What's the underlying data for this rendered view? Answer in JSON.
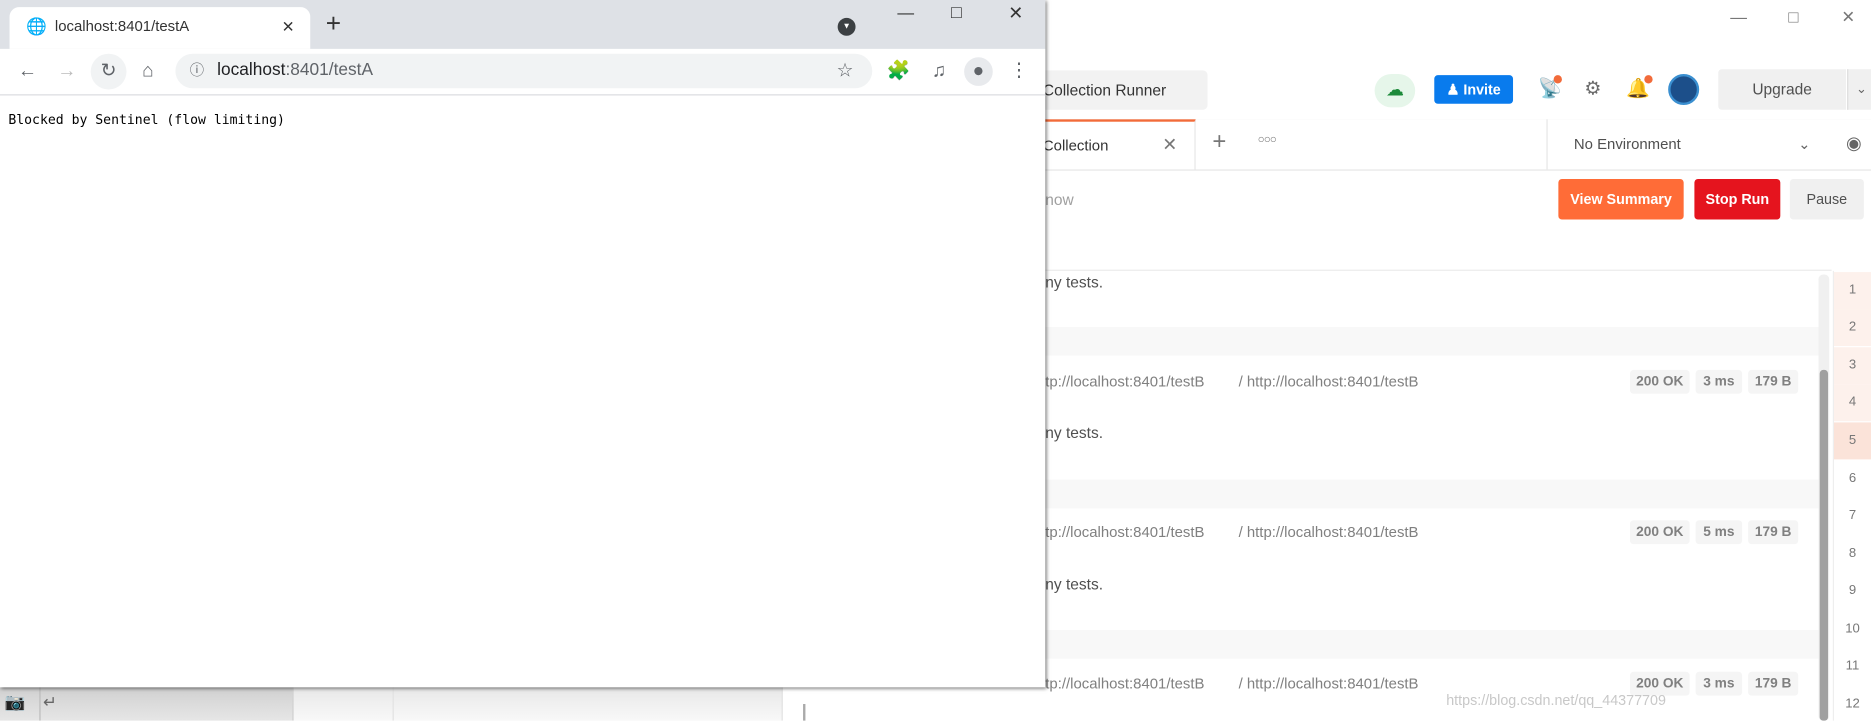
{
  "postman": {
    "header": {
      "runner_tab": "Collection Runner",
      "invite_label": "Invite",
      "upgrade_label": "Upgrade"
    },
    "tabs": {
      "active_tab": "Collection",
      "environment": "No Environment"
    },
    "run_bar": {
      "status_fragment": "now",
      "view_summary": "View Summary",
      "stop_run": "Stop Run",
      "pause": "Pause"
    },
    "results": [
      {
        "tests_text": "ny tests.",
        "url_fragment": "tp://localhost:8401/testB",
        "full_url": "/ http://localhost:8401/testB",
        "status": "200 OK",
        "time": "3 ms",
        "size": "179 B"
      },
      {
        "tests_text": "ny tests.",
        "url_fragment": "tp://localhost:8401/testB",
        "full_url": "/ http://localhost:8401/testB",
        "status": "200 OK",
        "time": "5 ms",
        "size": "179 B"
      },
      {
        "tests_text": "ny tests.",
        "url_fragment": "tp://localhost:8401/testB",
        "full_url": "/ http://localhost:8401/testB",
        "status": "200 OK",
        "time": "3 ms",
        "size": "179 B"
      }
    ],
    "line_numbers": [
      "1",
      "2",
      "3",
      "4",
      "5",
      "6",
      "7",
      "8",
      "9",
      "10",
      "11",
      "12"
    ],
    "watermark": "https://blog.csdn.net/qq_44377709",
    "colors": {
      "accent": "#f26b3a",
      "invite": "#097bed",
      "stop": "#e5141e",
      "view_summary": "#ff6c37"
    }
  },
  "chrome": {
    "tab_title": "localhost:8401/testA",
    "address_host": "localhost",
    "address_rest": ":8401/testA",
    "page_text": "Blocked by Sentinel (flow limiting)"
  }
}
